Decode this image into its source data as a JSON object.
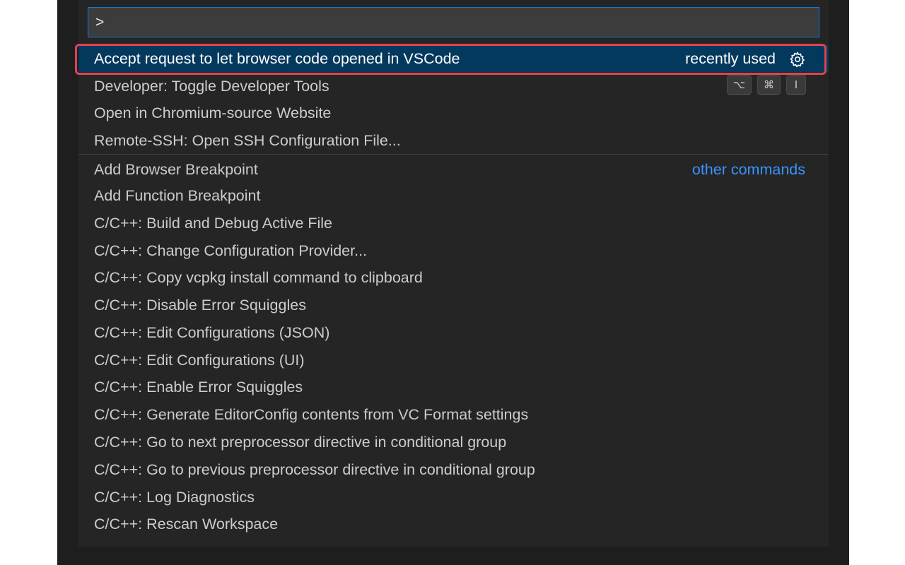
{
  "search": {
    "value": ">"
  },
  "recent": [
    {
      "label": "Accept request to let browser code opened in VSCode",
      "tag": "recently used",
      "icon": "gear-icon",
      "selected": true
    },
    {
      "label": "Developer: Toggle Developer Tools",
      "keybinding": [
        "⌥",
        "⌘",
        "I"
      ]
    },
    {
      "label": "Open in Chromium-source Website"
    },
    {
      "label": "Remote-SSH: Open SSH Configuration File..."
    }
  ],
  "other": {
    "tag": "other commands",
    "items": [
      "Add Browser Breakpoint",
      "Add Function Breakpoint",
      "C/C++: Build and Debug Active File",
      "C/C++: Change Configuration Provider...",
      "C/C++: Copy vcpkg install command to clipboard",
      "C/C++: Disable Error Squiggles",
      "C/C++: Edit Configurations (JSON)",
      "C/C++: Edit Configurations (UI)",
      "C/C++: Enable Error Squiggles",
      "C/C++: Generate EditorConfig contents from VC Format settings",
      "C/C++: Go to next preprocessor directive in conditional group",
      "C/C++: Go to previous preprocessor directive in conditional group",
      "C/C++: Log Diagnostics",
      "C/C++: Rescan Workspace"
    ]
  },
  "colors": {
    "selected_bg": "#04395e",
    "highlight_border": "#e04350",
    "accent_link": "#3794ff",
    "input_border": "#0e7bd6"
  }
}
